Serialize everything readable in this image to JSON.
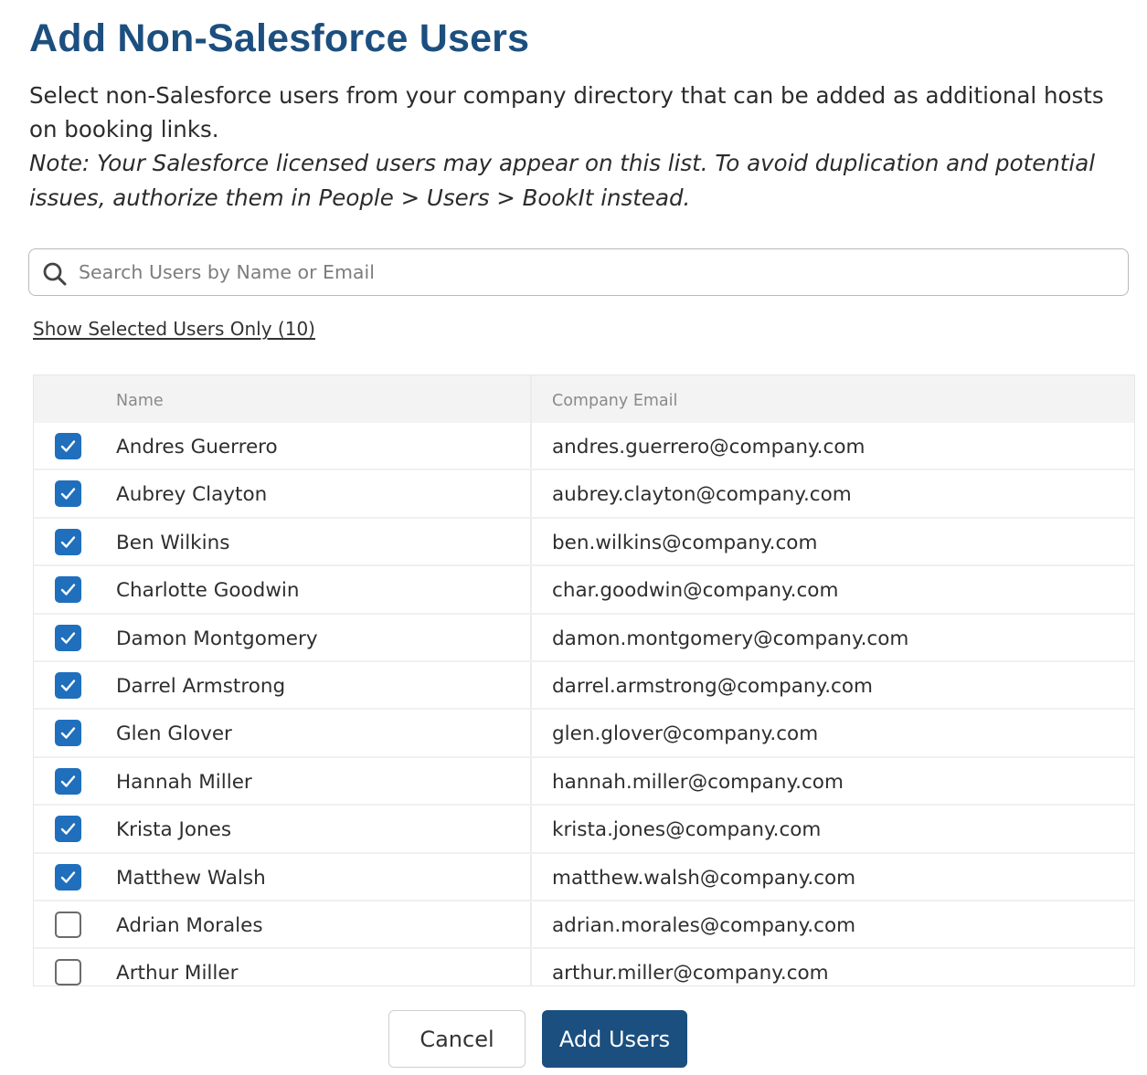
{
  "dialog": {
    "title": "Add Non-Salesforce Users",
    "description": "Select non-Salesforce users from your company directory that can be added as additional hosts on booking links.",
    "note": "Note: Your Salesforce licensed users may appear on this list. To avoid duplication and potential issues, authorize them in People > Users > BookIt instead."
  },
  "search": {
    "placeholder": "Search Users by Name or Email",
    "value": "",
    "icon": "search-icon"
  },
  "filter": {
    "show_selected_label": "Show Selected Users Only (10)"
  },
  "table": {
    "columns": [
      "Name",
      "Company Email"
    ],
    "rows": [
      {
        "name": "Andres Guerrero",
        "email": "andres.guerrero@company.com",
        "selected": true
      },
      {
        "name": "Aubrey Clayton",
        "email": "aubrey.clayton@company.com",
        "selected": true
      },
      {
        "name": "Ben Wilkins",
        "email": "ben.wilkins@company.com",
        "selected": true
      },
      {
        "name": "Charlotte Goodwin",
        "email": "char.goodwin@company.com",
        "selected": true
      },
      {
        "name": "Damon Montgomery",
        "email": "damon.montgomery@company.com",
        "selected": true
      },
      {
        "name": "Darrel Armstrong",
        "email": "darrel.armstrong@company.com",
        "selected": true
      },
      {
        "name": "Glen Glover",
        "email": "glen.glover@company.com",
        "selected": true
      },
      {
        "name": "Hannah Miller",
        "email": "hannah.miller@company.com",
        "selected": true
      },
      {
        "name": "Krista Jones",
        "email": "krista.jones@company.com",
        "selected": true
      },
      {
        "name": "Matthew Walsh",
        "email": "matthew.walsh@company.com",
        "selected": true
      },
      {
        "name": "Adrian Morales",
        "email": "adrian.morales@company.com",
        "selected": false
      },
      {
        "name": "Arthur Miller",
        "email": "arthur.miller@company.com",
        "selected": false
      }
    ]
  },
  "actions": {
    "cancel_label": "Cancel",
    "add_label": "Add Users"
  },
  "colors": {
    "title": "#1c4f7f",
    "checkbox_checked": "#1f6fbd",
    "primary_button": "#1a4f7f"
  }
}
